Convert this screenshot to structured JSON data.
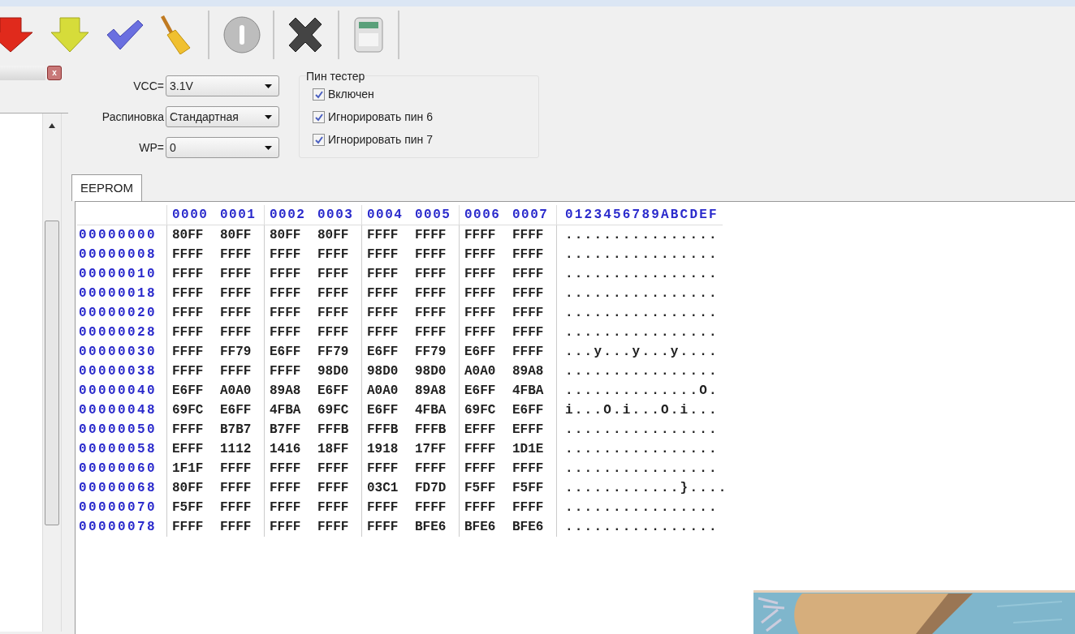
{
  "left_panel": {
    "close_button": "x"
  },
  "settings": [
    {
      "label": "VCC=",
      "value": "3.1V"
    },
    {
      "label": "Распиновка",
      "value": "Стандартная"
    },
    {
      "label": "WP=",
      "value": "0"
    }
  ],
  "pin_tester": {
    "title": "Пин тестер",
    "options": [
      {
        "label": "Включен",
        "checked": true
      },
      {
        "label": "Игнорировать пин 6",
        "checked": true
      },
      {
        "label": "Игнорировать пин 7",
        "checked": true
      }
    ]
  },
  "tabs": [
    {
      "label": "EEPROM",
      "selected": true
    }
  ],
  "hex_view": {
    "columns": [
      "0000",
      "0001",
      "0002",
      "0003",
      "0004",
      "0005",
      "0006",
      "0007"
    ],
    "ascii_header": "0123456789ABCDEF",
    "rows": [
      {
        "address": "00000000",
        "words": [
          "80FF",
          "80FF",
          "80FF",
          "80FF",
          "FFFF",
          "FFFF",
          "FFFF",
          "FFFF"
        ],
        "ascii": "................"
      },
      {
        "address": "00000008",
        "words": [
          "FFFF",
          "FFFF",
          "FFFF",
          "FFFF",
          "FFFF",
          "FFFF",
          "FFFF",
          "FFFF"
        ],
        "ascii": "................"
      },
      {
        "address": "00000010",
        "words": [
          "FFFF",
          "FFFF",
          "FFFF",
          "FFFF",
          "FFFF",
          "FFFF",
          "FFFF",
          "FFFF"
        ],
        "ascii": "................"
      },
      {
        "address": "00000018",
        "words": [
          "FFFF",
          "FFFF",
          "FFFF",
          "FFFF",
          "FFFF",
          "FFFF",
          "FFFF",
          "FFFF"
        ],
        "ascii": "................"
      },
      {
        "address": "00000020",
        "words": [
          "FFFF",
          "FFFF",
          "FFFF",
          "FFFF",
          "FFFF",
          "FFFF",
          "FFFF",
          "FFFF"
        ],
        "ascii": "................"
      },
      {
        "address": "00000028",
        "words": [
          "FFFF",
          "FFFF",
          "FFFF",
          "FFFF",
          "FFFF",
          "FFFF",
          "FFFF",
          "FFFF"
        ],
        "ascii": "................"
      },
      {
        "address": "00000030",
        "words": [
          "FFFF",
          "FF79",
          "E6FF",
          "FF79",
          "E6FF",
          "FF79",
          "E6FF",
          "FFFF"
        ],
        "ascii": "...y...y...y...."
      },
      {
        "address": "00000038",
        "words": [
          "FFFF",
          "FFFF",
          "FFFF",
          "98D0",
          "98D0",
          "98D0",
          "A0A0",
          "89A8"
        ],
        "ascii": "................"
      },
      {
        "address": "00000040",
        "words": [
          "E6FF",
          "A0A0",
          "89A8",
          "E6FF",
          "A0A0",
          "89A8",
          "E6FF",
          "4FBA"
        ],
        "ascii": "..............O."
      },
      {
        "address": "00000048",
        "words": [
          "69FC",
          "E6FF",
          "4FBA",
          "69FC",
          "E6FF",
          "4FBA",
          "69FC",
          "E6FF"
        ],
        "ascii": "i...O.i...O.i..."
      },
      {
        "address": "00000050",
        "words": [
          "FFFF",
          "B7B7",
          "B7FF",
          "FFFB",
          "FFFB",
          "FFFB",
          "EFFF",
          "EFFF"
        ],
        "ascii": "................"
      },
      {
        "address": "00000058",
        "words": [
          "EFFF",
          "1112",
          "1416",
          "18FF",
          "1918",
          "17FF",
          "FFFF",
          "1D1E"
        ],
        "ascii": "................"
      },
      {
        "address": "00000060",
        "words": [
          "1F1F",
          "FFFF",
          "FFFF",
          "FFFF",
          "FFFF",
          "FFFF",
          "FFFF",
          "FFFF"
        ],
        "ascii": "................"
      },
      {
        "address": "00000068",
        "words": [
          "80FF",
          "FFFF",
          "FFFF",
          "FFFF",
          "03C1",
          "FD7D",
          "F5FF",
          "F5FF"
        ],
        "ascii": "............}...."
      },
      {
        "address": "00000070",
        "words": [
          "F5FF",
          "FFFF",
          "FFFF",
          "FFFF",
          "FFFF",
          "FFFF",
          "FFFF",
          "FFFF"
        ],
        "ascii": "................"
      },
      {
        "address": "00000078",
        "words": [
          "FFFF",
          "FFFF",
          "FFFF",
          "FFFF",
          "FFFF",
          "BFE6",
          "BFE6",
          "BFE6"
        ],
        "ascii": "................"
      }
    ]
  }
}
